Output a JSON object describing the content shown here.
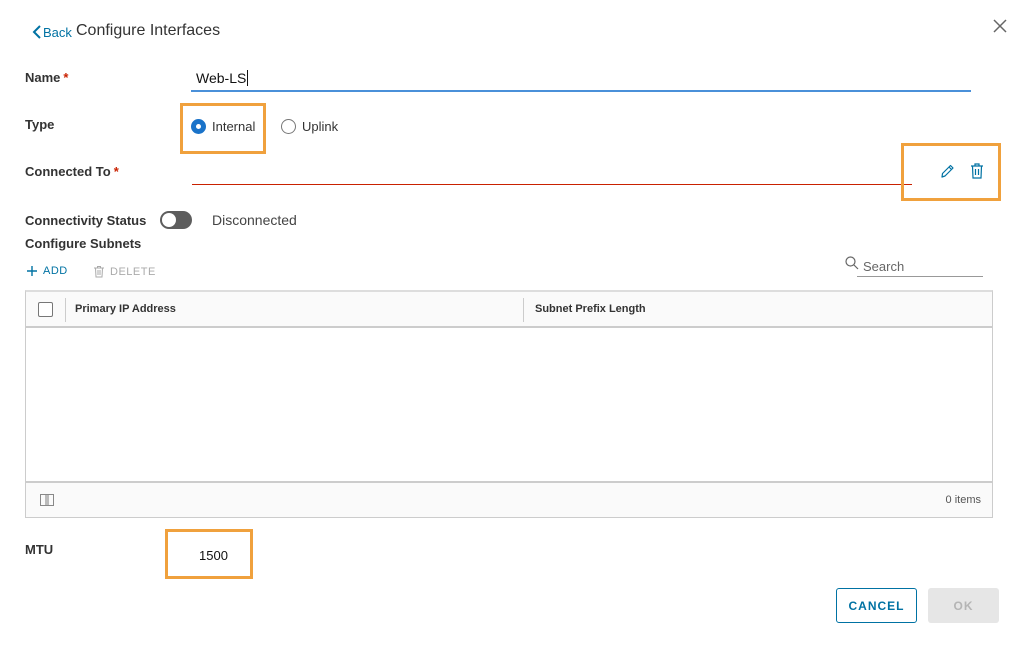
{
  "header": {
    "back_label": "Back",
    "title": "Configure Interfaces"
  },
  "form": {
    "name": {
      "label": "Name",
      "required_mark": "*",
      "value": "Web-LS"
    },
    "type": {
      "label": "Type",
      "options": [
        {
          "label": "Internal",
          "selected": true
        },
        {
          "label": "Uplink",
          "selected": false
        }
      ]
    },
    "connected_to": {
      "label": "Connected To",
      "required_mark": "*",
      "value": ""
    },
    "connectivity_status": {
      "label": "Connectivity Status",
      "value": "Disconnected",
      "enabled": false
    },
    "mtu": {
      "label": "MTU",
      "value": "1500"
    }
  },
  "subnets": {
    "section_title": "Configure Subnets",
    "add_label": "ADD",
    "delete_label": "DELETE",
    "search_placeholder": "Search",
    "columns": [
      "Primary IP Address",
      "Subnet Prefix Length"
    ],
    "rows": [],
    "item_count": "0 items"
  },
  "footer": {
    "cancel_label": "CANCEL",
    "ok_label": "OK"
  },
  "colors": {
    "accent": "#0072a3",
    "highlight": "#f0a13d",
    "error": "#c92100",
    "focus_underline": "#4a90d9"
  },
  "icons": [
    "chevron-left-icon",
    "close-icon",
    "pencil-icon",
    "trash-icon",
    "plus-icon",
    "search-icon",
    "column-toggle-icon"
  ]
}
